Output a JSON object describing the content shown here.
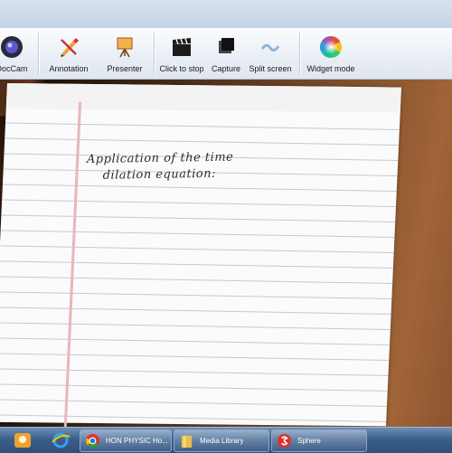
{
  "toolbar": {
    "items": [
      {
        "label": "DocCam",
        "icon": "doccam-lens-icon"
      },
      {
        "label": "Annotation",
        "icon": "pencil-icon"
      },
      {
        "label": "Presenter",
        "icon": "presenter-easel-icon"
      },
      {
        "label": "Click to stop",
        "icon": "clapperboard-icon"
      },
      {
        "label": "Capture",
        "icon": "capture-icon"
      },
      {
        "label": "Split screen",
        "icon": "split-screen-icon"
      },
      {
        "label": "Widget mode",
        "icon": "color-wheel-icon"
      }
    ]
  },
  "camera_view": {
    "handwriting_line1": "Application of the time",
    "handwriting_line2": "dilation equation:"
  },
  "taskbar": {
    "buttons": [
      {
        "label": "HON PHYSIC Ho...",
        "icon": "chrome-icon"
      },
      {
        "label": "Media Library",
        "icon": "folder-icon"
      },
      {
        "label": "Sphere",
        "icon": "sphere-app-icon"
      }
    ]
  },
  "colors": {
    "taskbar": "#3b5f8c",
    "toolbar": "#e9eef5",
    "paper": "#fbfbfb"
  }
}
